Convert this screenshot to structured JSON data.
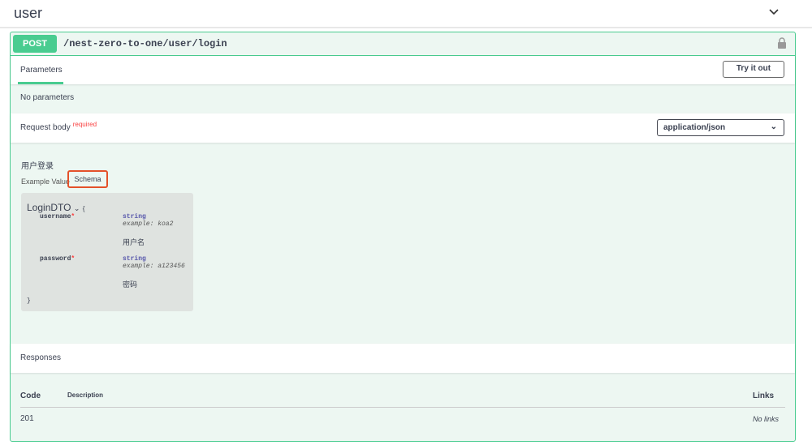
{
  "tag": {
    "title": "user"
  },
  "operation": {
    "method": "POST",
    "path": "/nest-zero-to-one/user/login",
    "accent": "#49cc90"
  },
  "parameters": {
    "tab": "Parameters",
    "try_label": "Try it out",
    "empty": "No parameters"
  },
  "request_body": {
    "title": "Request body",
    "required": "required",
    "content_type": "application/json",
    "description": "用户登录",
    "example_tab": "Example Value",
    "schema_tab": "Schema"
  },
  "schema": {
    "name": "LoginDTO",
    "open": "{",
    "close": "}",
    "properties": [
      {
        "name": "username",
        "required": "*",
        "type": "string",
        "example": "example: koa2",
        "description": "用户名"
      },
      {
        "name": "password",
        "required": "*",
        "type": "string",
        "example": "example: a123456",
        "description": "密码"
      }
    ]
  },
  "responses": {
    "title": "Responses",
    "columns": [
      "Code",
      "Description",
      "Links"
    ],
    "rows": [
      {
        "code": "201",
        "description": "",
        "links": "No links"
      }
    ]
  }
}
